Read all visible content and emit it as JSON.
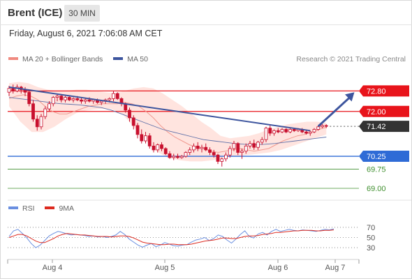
{
  "header": {
    "instrument": "Brent (ICE)",
    "timeframe": "30 MIN"
  },
  "timestamp": "Friday, August 6, 2021 7:06:08 AM CET",
  "copyright": "Research © 2021 Trading Central",
  "legend": {
    "ma20": "MA 20 + Bollinger Bands",
    "ma50": "MA 50",
    "rsi": "RSI",
    "ma9": "9MA"
  },
  "colors": {
    "candle": "#c8102e",
    "bollinger_fill": "#ffe1dc",
    "ma20": "#f19a90",
    "ma50": "#5e6fa8",
    "trend": "#3d559e",
    "resistance": "#e8141b",
    "support": "#2f6bd6",
    "target": "#3f8f2e",
    "last": "#333333",
    "rsi": "#6a8fe0",
    "rsi_ma": "#dd2a1f",
    "legend_ma20": "#f08a80",
    "legend_ma50": "#3d559e",
    "legend_rsi": "#6a8fe0",
    "legend_ma9": "#dd2a1f"
  },
  "chart_data": [
    {
      "type": "candlestick",
      "x_tick_labels": [
        "Aug 4",
        "Aug 5",
        "Aug 6",
        "Aug 7"
      ],
      "ylim": [
        68.7,
        73.3
      ],
      "candles": [
        [
          72.75,
          73.0,
          72.6,
          72.9
        ],
        [
          72.9,
          73.05,
          72.7,
          72.8
        ],
        [
          72.8,
          73.05,
          72.75,
          72.95
        ],
        [
          72.95,
          73.0,
          72.7,
          72.85
        ],
        [
          72.85,
          72.95,
          72.6,
          72.75
        ],
        [
          72.75,
          72.85,
          72.2,
          72.3
        ],
        [
          72.3,
          72.45,
          71.6,
          71.7
        ],
        [
          71.7,
          71.85,
          71.25,
          71.4
        ],
        [
          71.4,
          71.9,
          71.3,
          71.8
        ],
        [
          71.8,
          72.2,
          71.7,
          72.1
        ],
        [
          72.1,
          72.4,
          72.0,
          72.3
        ],
        [
          72.3,
          72.6,
          72.2,
          72.55
        ],
        [
          72.55,
          72.7,
          72.4,
          72.6
        ],
        [
          72.6,
          72.65,
          72.35,
          72.45
        ],
        [
          72.45,
          72.6,
          72.35,
          72.55
        ],
        [
          72.55,
          72.6,
          72.4,
          72.45
        ],
        [
          72.45,
          72.55,
          72.35,
          72.5
        ],
        [
          72.5,
          72.6,
          72.4,
          72.45
        ],
        [
          72.45,
          72.55,
          72.3,
          72.4
        ],
        [
          72.4,
          72.5,
          72.3,
          72.45
        ],
        [
          72.45,
          72.55,
          72.35,
          72.4
        ],
        [
          72.4,
          72.5,
          72.3,
          72.45
        ],
        [
          72.45,
          72.5,
          72.3,
          72.35
        ],
        [
          72.35,
          72.45,
          72.25,
          72.4
        ],
        [
          72.4,
          72.5,
          72.3,
          72.45
        ],
        [
          72.45,
          72.55,
          72.35,
          72.5
        ],
        [
          72.5,
          72.8,
          72.4,
          72.7
        ],
        [
          72.7,
          72.75,
          72.45,
          72.5
        ],
        [
          72.5,
          72.55,
          72.2,
          72.3
        ],
        [
          72.3,
          72.35,
          71.95,
          72.05
        ],
        [
          72.05,
          72.15,
          71.6,
          71.75
        ],
        [
          71.75,
          71.85,
          71.3,
          71.45
        ],
        [
          71.45,
          71.55,
          70.95,
          71.1
        ],
        [
          71.1,
          71.3,
          70.75,
          70.85
        ],
        [
          70.85,
          71.2,
          70.75,
          71.05
        ],
        [
          71.05,
          71.15,
          70.55,
          70.65
        ],
        [
          70.65,
          70.8,
          70.4,
          70.5
        ],
        [
          70.5,
          70.75,
          70.4,
          70.7
        ],
        [
          70.7,
          70.8,
          70.45,
          70.55
        ],
        [
          70.55,
          70.6,
          70.3,
          70.35
        ],
        [
          70.35,
          70.45,
          70.15,
          70.2
        ],
        [
          70.2,
          70.35,
          70.1,
          70.25
        ],
        [
          70.25,
          70.35,
          70.15,
          70.2
        ],
        [
          70.2,
          70.3,
          70.15,
          70.25
        ],
        [
          70.25,
          70.45,
          70.2,
          70.4
        ],
        [
          70.4,
          70.6,
          70.3,
          70.5
        ],
        [
          70.5,
          70.75,
          70.4,
          70.65
        ],
        [
          70.65,
          70.8,
          70.45,
          70.55
        ],
        [
          70.55,
          70.7,
          70.4,
          70.6
        ],
        [
          70.6,
          70.75,
          70.45,
          70.5
        ],
        [
          70.5,
          70.6,
          70.3,
          70.4
        ],
        [
          70.4,
          70.5,
          70.2,
          70.3
        ],
        [
          70.3,
          70.35,
          69.95,
          70.05
        ],
        [
          70.05,
          70.2,
          69.85,
          70.15
        ],
        [
          70.15,
          70.4,
          70.05,
          70.3
        ],
        [
          70.3,
          70.65,
          70.2,
          70.55
        ],
        [
          70.55,
          70.85,
          70.45,
          70.75
        ],
        [
          70.75,
          70.8,
          70.3,
          70.4
        ],
        [
          70.4,
          70.55,
          70.15,
          70.45
        ],
        [
          70.45,
          70.75,
          70.35,
          70.65
        ],
        [
          70.65,
          70.85,
          70.55,
          70.75
        ],
        [
          70.75,
          70.9,
          70.5,
          70.6
        ],
        [
          70.6,
          70.85,
          70.5,
          70.8
        ],
        [
          70.8,
          71.0,
          70.7,
          70.9
        ],
        [
          70.9,
          71.4,
          70.8,
          71.35
        ],
        [
          71.35,
          71.45,
          71.05,
          71.15
        ],
        [
          71.15,
          71.3,
          71.05,
          71.25
        ],
        [
          71.25,
          71.35,
          71.15,
          71.2
        ],
        [
          71.2,
          71.35,
          71.15,
          71.3
        ],
        [
          71.3,
          71.35,
          71.15,
          71.2
        ],
        [
          71.2,
          71.35,
          71.15,
          71.3
        ],
        [
          71.3,
          71.35,
          71.2,
          71.25
        ],
        [
          71.25,
          71.35,
          71.2,
          71.3
        ],
        [
          71.3,
          71.35,
          71.15,
          71.2
        ],
        [
          71.2,
          71.3,
          71.1,
          71.15
        ],
        [
          71.15,
          71.25,
          71.05,
          71.2
        ],
        [
          71.2,
          71.35,
          71.15,
          71.3
        ],
        [
          71.3,
          71.45,
          71.25,
          71.4
        ],
        [
          71.4,
          71.5,
          71.35,
          71.45
        ],
        [
          71.45,
          71.5,
          71.35,
          71.42
        ]
      ],
      "ma20": [
        72.5,
        72.6,
        72.65,
        72.6,
        72.45,
        72.2,
        72.0,
        71.9,
        71.9,
        72.0,
        72.1,
        72.2,
        72.25,
        72.3,
        72.3,
        72.3,
        72.35,
        72.3,
        72.2,
        72.0,
        71.75,
        71.45,
        71.2,
        71.0,
        70.85,
        70.7,
        70.6,
        70.55,
        70.45,
        70.4,
        70.45,
        70.5,
        70.55,
        70.5,
        70.45,
        70.5,
        70.55,
        70.7,
        70.85,
        70.95,
        71.05,
        71.1,
        71.2,
        71.3,
        71.38
      ],
      "ma50": [
        72.55,
        72.5,
        72.45,
        72.4,
        72.35,
        72.3,
        72.28,
        72.25,
        72.2,
        72.15,
        72.05,
        71.9,
        71.75,
        71.6,
        71.45,
        71.3,
        71.2,
        71.1,
        71.0,
        70.9,
        70.85,
        70.8,
        70.75,
        70.72,
        70.7,
        70.72,
        70.75,
        70.8,
        70.85,
        70.9,
        70.95,
        71.0
      ],
      "bollinger_upper": [
        73.1,
        73.15,
        73.1,
        72.95,
        72.85,
        72.8,
        72.8,
        72.85,
        72.85,
        72.8,
        72.75,
        72.7,
        72.8,
        72.9,
        72.95,
        72.9,
        72.7,
        72.45,
        72.2,
        71.9,
        71.6,
        71.35,
        71.05,
        70.95,
        71.0,
        71.05,
        71.15,
        71.3,
        71.4,
        71.5,
        71.55,
        71.6,
        71.6,
        71.55
      ],
      "bollinger_lower": [
        72.2,
        71.6,
        71.2,
        71.2,
        71.4,
        71.7,
        71.95,
        72.05,
        72.1,
        72.1,
        71.9,
        71.4,
        70.9,
        70.45,
        70.2,
        70.1,
        70.05,
        70.05,
        70.1,
        70.2,
        70.25,
        70.3,
        70.35,
        70.4,
        70.5,
        70.65,
        70.8,
        70.95,
        71.1
      ],
      "trendline": [
        [
          0,
          72.95
        ],
        [
          75,
          71.25
        ]
      ],
      "forecast_arrow": [
        [
          77,
          71.42
        ],
        [
          86,
          72.75
        ]
      ],
      "levels": [
        {
          "value": 72.8,
          "label": "72.80",
          "kind": "resistance"
        },
        {
          "value": 72.0,
          "label": "72.00",
          "kind": "resistance"
        },
        {
          "value": 71.42,
          "label": "71.42",
          "kind": "last"
        },
        {
          "value": 70.25,
          "label": "70.25",
          "kind": "support"
        },
        {
          "value": 69.75,
          "label": "69.75",
          "kind": "target"
        },
        {
          "value": 69.0,
          "label": "69.00",
          "kind": "target"
        }
      ]
    },
    {
      "type": "line",
      "title": "RSI",
      "ylim": [
        15,
        85
      ],
      "y_ticks": [
        70,
        50,
        30
      ],
      "series": [
        {
          "name": "RSI",
          "values": [
            52,
            63,
            66,
            58,
            49,
            38,
            30,
            35,
            44,
            53,
            58,
            62,
            60,
            57,
            55,
            56,
            55,
            54,
            52,
            53,
            51,
            52,
            50,
            52,
            55,
            62,
            56,
            47,
            41,
            35,
            31,
            35,
            38,
            32,
            35,
            40,
            37,
            34,
            33,
            35,
            36,
            41,
            45,
            47,
            50,
            44,
            48,
            55,
            52,
            45,
            39,
            47,
            56,
            63,
            52,
            49,
            57,
            60,
            55,
            62,
            66,
            62,
            64,
            66,
            64,
            63,
            65,
            64,
            63,
            62,
            64,
            66,
            65,
            67
          ]
        },
        {
          "name": "9MA",
          "values": [
            50,
            53,
            56,
            56,
            53,
            48,
            43,
            40,
            40,
            44,
            48,
            53,
            56,
            58,
            57,
            56,
            55,
            55,
            54,
            53,
            52,
            52,
            52,
            51,
            52,
            53,
            53,
            52,
            49,
            45,
            41,
            39,
            38,
            37,
            36,
            36,
            37,
            37,
            36,
            36,
            36,
            37,
            39,
            41,
            43,
            44,
            45,
            47,
            49,
            49,
            48,
            48,
            50,
            52,
            53,
            53,
            54,
            56,
            57,
            58,
            60,
            60,
            61,
            62,
            63,
            63,
            64,
            64,
            64,
            63,
            63,
            64,
            64,
            65
          ]
        }
      ]
    }
  ]
}
